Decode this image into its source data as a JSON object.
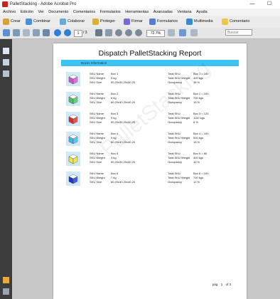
{
  "window": {
    "title": "PalletStacking - Adobe Acrobat Pro",
    "minimize": "—",
    "maximize": "☐"
  },
  "menu": [
    "Archivo",
    "Edición",
    "Ver",
    "Documento",
    "Comentarios",
    "Formularios",
    "Herramientas",
    "Avanzadas",
    "Ventana",
    "Ayuda"
  ],
  "toolbar": {
    "crear": "Crear",
    "combinar": "Combinar",
    "colaborar": "Colaborar",
    "proteger": "Proteger",
    "firmar": "Firmar",
    "formularios": "Formularios",
    "multimedia": "Multimedia",
    "comentario": "Comentario"
  },
  "nav": {
    "page_current": "1",
    "page_total": "/ 3",
    "zoom": "72.7%",
    "search_placeholder": "Buscar"
  },
  "report": {
    "title": "Dispatch PalletStacking Report",
    "section": "Boxes Information",
    "watermark": "PalletStacking",
    "labels": {
      "name": "SKU Name",
      "weight": "SKU Weight",
      "size": "SKU Size",
      "total_sku": "Total SKU",
      "total_weight": "Total SKU Weight",
      "occupancy": "Occupancy"
    },
    "rows": [
      {
        "color": "#d94fd1",
        "name": "Box 1",
        "weight": "5 kg",
        "size": "60,20x30,20x30,20",
        "total_sku": "Box 1 = 100",
        "total_weight": "400 kgs",
        "occupancy": "18 %"
      },
      {
        "color": "#49c25a",
        "name": "Box 2",
        "weight": "6 kg",
        "size": "60,20x30,20x30,20",
        "total_sku": "Box 2 = 100",
        "total_weight": "700 kgs",
        "occupancy": "15 %"
      },
      {
        "color": "#e02a2a",
        "name": "Box 3",
        "weight": "9 kg",
        "size": "60,20x30,20x30,20",
        "total_sku": "Box 3 = 120",
        "total_weight": "1100 kgs",
        "occupancy": "8 %"
      },
      {
        "color": "#3fb7e6",
        "name": "Box 4",
        "weight": "5 kg",
        "size": "60,20x30,20x30,20",
        "total_sku": "Box 4 = 100",
        "total_weight": "500 kgs",
        "occupancy": "15 %"
      },
      {
        "color": "#f2e63a",
        "name": "Box 5",
        "weight": "3 kg",
        "size": "60,20x30,20x30,20",
        "total_sku": "Box 5 = 80",
        "total_weight": "400 kgs",
        "occupancy": "10 %"
      },
      {
        "color": "#1b35c4",
        "name": "Box 6",
        "weight": "7 kg",
        "size": "60,20x30,20x30,20",
        "total_sku": "Box 6 = 100",
        "total_weight": "700 kgs",
        "occupancy": "12 %"
      }
    ],
    "footer": {
      "page_label": "pag",
      "page_num": "1",
      "of_label": "of 3"
    }
  }
}
